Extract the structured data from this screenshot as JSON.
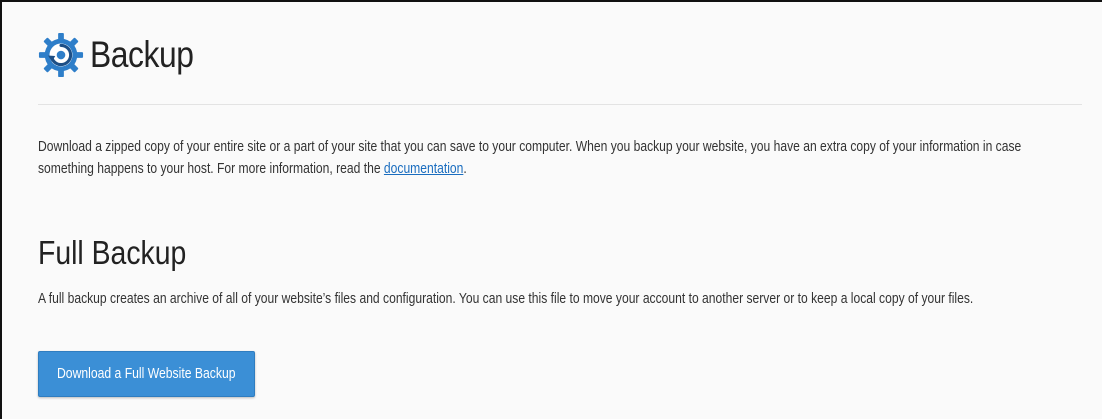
{
  "header": {
    "title": "Backup",
    "icon": "backup-gear-icon"
  },
  "intro": {
    "text": "Download a zipped copy of your entire site or a part of your site that you can save to your computer. When you backup your website, you have an extra copy of your information in case something happens to your host. For more information, read the ",
    "link_label": "documentation",
    "suffix": "."
  },
  "full_backup": {
    "title": "Full Backup",
    "description": "A full backup creates an archive of all of your website’s files and configuration. You can use this file to move your account to another server or to keep a local copy of your files.",
    "button_label": "Download a Full Website Backup"
  },
  "colors": {
    "accent": "#3b8fd6",
    "link": "#1a6dbf",
    "icon_blue": "#2e7ec9",
    "icon_dark": "#1d4f86"
  }
}
